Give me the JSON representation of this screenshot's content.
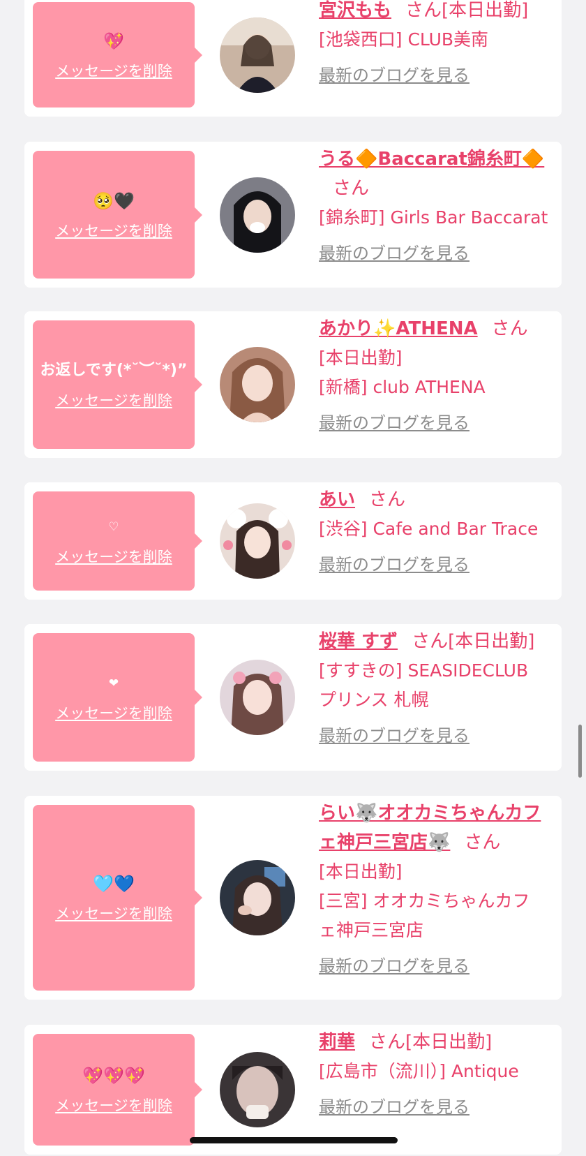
{
  "colors": {
    "accent": "#e8416a",
    "bubble": "#ff97a8",
    "link_gray": "#8c8c8c",
    "background": "#f2f2f4"
  },
  "san_label": "さん",
  "delete_label": "メッセージを削除",
  "blog_label": "最新のブログを見る",
  "cards": [
    {
      "message": "💖",
      "name": "宮沢もも",
      "suffix": "[本日出勤]",
      "lines": [
        "[池袋西口] CLUB美南"
      ]
    },
    {
      "message": "🥺🖤",
      "name": "うる🔶Baccarat錦糸町🔶",
      "suffix": "",
      "lines": [
        "[錦糸町] Girls Bar Baccarat"
      ]
    },
    {
      "message": "お返しです(*˘︶˘*)”",
      "name": "あかり✨ATHENA",
      "suffix": "",
      "lines": [
        "[本日出勤]",
        "[新橋] club ATHENA"
      ]
    },
    {
      "message": "♡",
      "name": "あい",
      "suffix": "",
      "lines": [
        "[渋谷] Cafe and Bar Trace"
      ]
    },
    {
      "message": "❤",
      "name": "桜華 すず",
      "suffix": "[本日出勤]",
      "lines": [
        "[すすきの] SEASIDECLUB",
        "プリンス 札幌"
      ]
    },
    {
      "message": "🩵💙",
      "name": "らい🐺オオカミちゃんカフェ神戸三宮店🐺",
      "suffix": "",
      "lines": [
        "[本日出勤]",
        "[三宮] オオカミちゃんカフ",
        "ェ神戸三宮店"
      ]
    },
    {
      "message": "💖💖💖",
      "name": "莉華",
      "suffix": "[本日出勤]",
      "lines": [
        "[広島市（流川）] Antique"
      ]
    }
  ]
}
